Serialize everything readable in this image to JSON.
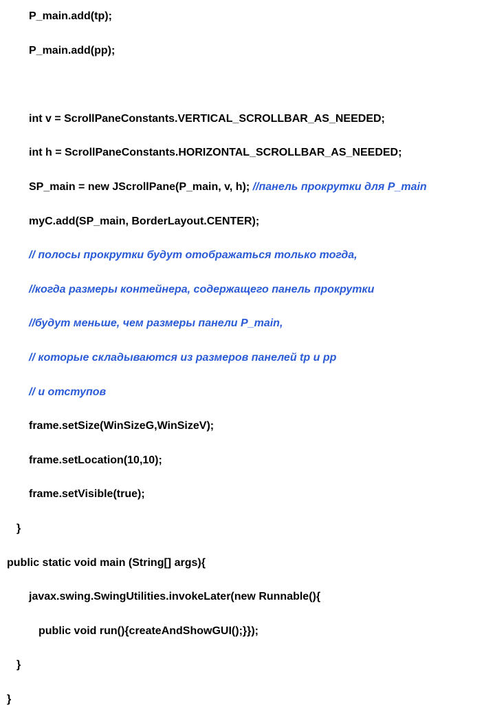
{
  "code": {
    "l1": "P_main.add(tp);",
    "l2": "P_main.add(pp);",
    "l3": "int v = ScrollPaneConstants.VERTICAL_SCROLLBAR_AS_NEEDED;",
    "l4": "int h = ScrollPaneConstants.HORIZONTAL_SCROLLBAR_AS_NEEDED;",
    "l5a": "SP_main = new JScrollPane(P_main, v, h); ",
    "l5b": "//панель прокрутки для P_main",
    "l6": "myC.add(SP_main, BorderLayout.CENTER);",
    "l7": "// полосы прокрутки будут отображаться только тогда,",
    "l8": "//когда размеры контейнера, содержащего панель прокрутки",
    "l9": "//будут меньше, чем размеры панели P_main,",
    "l10": "// которые складываются из размеров панелей tp и pp",
    "l11": "// и отступов",
    "l12": "frame.setSize(WinSizeG,WinSizeV);",
    "l13": "frame.setLocation(10,10);",
    "l14": "frame.setVisible(true);",
    "l15": "}",
    "l16": "public static void main (String[] args){",
    "l17": "javax.swing.SwingUtilities.invokeLater(new Runnable(){",
    "l18": "public void run(){createAndShowGUI();}});",
    "l19": "}",
    "l20": "}"
  }
}
